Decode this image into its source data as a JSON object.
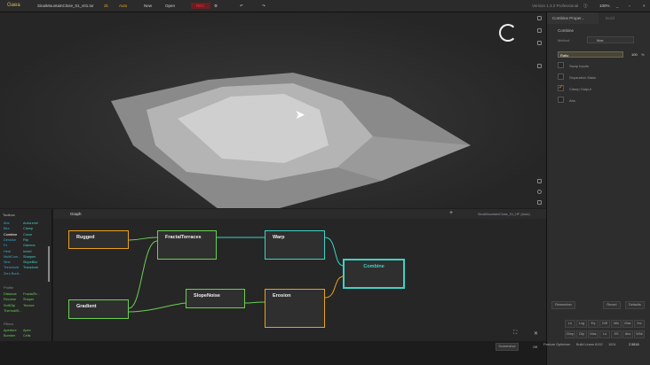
{
  "topbar": {
    "app": "Gaea",
    "file": "SinaiMountainClose_01_v01.tor",
    "res": "2k",
    "mode": "Auto",
    "new": "New",
    "open": "Open",
    "rec": "REC",
    "version": "Version 1.3.2 Professional",
    "zoom": "100%"
  },
  "properties": {
    "tab1": "Combine Proper...",
    "tab2": "Build",
    "section": "Combine",
    "method_label": "Method",
    "method_value": "Max",
    "ratio_label": "Ratio",
    "ratio_value": "100",
    "ratio_unit": "%",
    "ratio_fraction": 1.0,
    "options": [
      {
        "label": "Swap Inputs",
        "checked": false
      },
      {
        "label": "Separation Mask",
        "checked": false
      },
      {
        "label": "Clamp Output",
        "checked": true
      },
      {
        "label": "Abs",
        "checked": false
      }
    ],
    "remember": "Remember",
    "revert": "Revert",
    "defaults": "Defaults",
    "keys_row1": [
      "Ln",
      "Log",
      "Eq",
      "Diff",
      "Min",
      "Max",
      "Inv"
    ],
    "keys_row2": [
      "Clmp",
      "Clip",
      "Mas",
      "Ls",
      "SS",
      "Abs",
      "Whk"
    ]
  },
  "toolbox": {
    "title": "Toolbox",
    "items": [
      "Abs",
      "AutoLevel",
      "Blur",
      "Clamp",
      "Combine",
      "Curve",
      "Denoise",
      "Flip",
      "Fx",
      "Gamma",
      "Heal",
      "Invert",
      "MultiCom...",
      "Sharpen",
      "Sine",
      "SlopeBlur",
      "Threshold",
      "Transform",
      "Zero Bord..."
    ],
    "profile_section": "Profile",
    "profile_items": [
      "Distance",
      "FractalTe...",
      "Recurse",
      "Shaper",
      "SoftClip",
      "Terrace",
      "ThermalSl..."
    ],
    "filters_section": "Filters",
    "filters_items": [
      "Aperture",
      "Apex",
      "Bomber",
      "Cells"
    ]
  },
  "graph": {
    "tab": "Graph",
    "file": "SinaiMountainClose_01_HF (Auto)",
    "nodes": [
      {
        "name": "Rugged"
      },
      {
        "name": "FractalTerraces"
      },
      {
        "name": "Warp"
      },
      {
        "name": "Combine"
      },
      {
        "name": "Gradient"
      },
      {
        "name": "SlopeNoise"
      },
      {
        "name": "Erosion"
      }
    ]
  },
  "status": {
    "screenshot": "Screenshot",
    "off": "Off",
    "feature": "Feature Optimizer",
    "buildres": "Build Linear 8192",
    "res": "1024",
    "value": "2.5818"
  },
  "colors": {
    "orange": "#e8a21c",
    "green": "#6ccf54",
    "teal": "#3fd2c4"
  }
}
